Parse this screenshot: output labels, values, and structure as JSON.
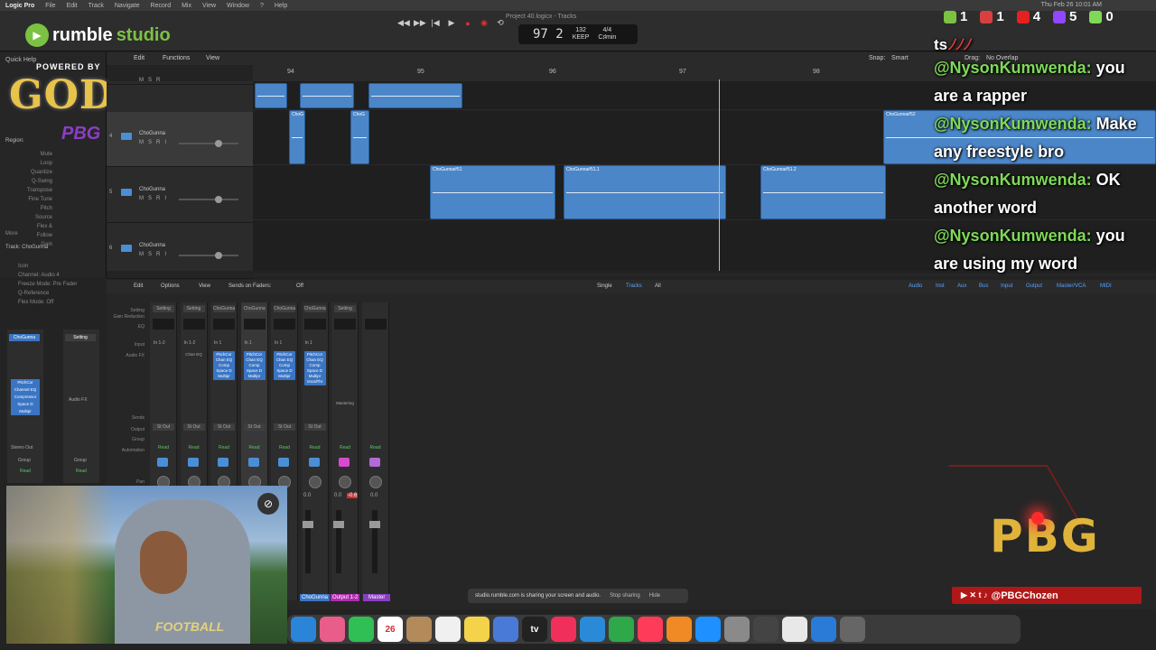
{
  "menubar": {
    "app": "Logic Pro",
    "items": [
      "File",
      "Edit",
      "Track",
      "Navigate",
      "Record",
      "Mix",
      "View",
      "Window",
      "?",
      "Help"
    ],
    "clock": "Thu Feb 26 10:01 AM"
  },
  "window": {
    "title": "Project 40.logicx - Tracks"
  },
  "transport": {
    "rewind": "◀◀",
    "forward": "▶▶",
    "to_start": "|◀",
    "play": "▶",
    "record": "●",
    "capture": "◉",
    "cycle": "⟲",
    "position": "97 2",
    "tempo": "132",
    "tempo_label": "KEEP",
    "signature": "4/4",
    "key": "C♯min"
  },
  "rumble": {
    "brand": "rumble",
    "product": "studio"
  },
  "viewers": [
    {
      "platform": "rumble",
      "count": "1",
      "color": "#7bc242"
    },
    {
      "platform": "kick",
      "count": "1",
      "color": "#d84040"
    },
    {
      "platform": "youtube",
      "count": "4",
      "color": "#e62020"
    },
    {
      "platform": "twitch",
      "count": "5",
      "color": "#9146ff"
    },
    {
      "platform": "link",
      "count": "0",
      "color": "#7fd957"
    }
  ],
  "tracks_toolbar": {
    "edit": "Edit",
    "functions": "Functions",
    "view": "View",
    "snap_label": "Snap:",
    "snap_value": "Smart",
    "drag_label": "Drag:",
    "drag_value": "No Overlap"
  },
  "inspector": {
    "quick_help": "Quick Help",
    "region_label": "Region:",
    "track_label": "Track: ChoGunna",
    "rows": [
      "Mute",
      "Loop",
      "Quantize",
      "Q-Swing",
      "Transpose",
      "Fine Tune",
      "Pitch Source",
      "Flex & Follow",
      "Gain",
      "More",
      "Icon",
      "Channel: Audio 4",
      "Freeze Mode: Pre Fader",
      "Q-Reference",
      "Flex Mode: Off"
    ]
  },
  "overlay_logo": {
    "powered_by": "POWERED BY",
    "god": "GOD",
    "pbg": "PBG"
  },
  "tracks": [
    {
      "num": "",
      "name": "",
      "selected": false
    },
    {
      "num": "4",
      "name": "ChoGunna",
      "selected": true
    },
    {
      "num": "5",
      "name": "ChoGunna",
      "selected": false
    },
    {
      "num": "6",
      "name": "ChoGunna",
      "selected": false
    }
  ],
  "track_buttons": [
    "M",
    "S",
    "R",
    "I"
  ],
  "ruler": {
    "marks": [
      "94",
      "95",
      "96",
      "97",
      "98"
    ]
  },
  "regions": {
    "r1": "ChoG",
    "r2": "ChoG",
    "r3": "ChoGunna#52",
    "r4": "ChoGunna#51",
    "r5": "ChoGunna#51.1",
    "r6": "ChoGunna#51.2"
  },
  "mixer_toolbar": {
    "edit": "Edit",
    "options": "Options",
    "view": "View",
    "sends_on_faders": "Sends on Faders:",
    "sends_value": "Off",
    "single": "Single",
    "tracks": "Tracks",
    "all": "All",
    "filters": [
      "Audio",
      "Inst",
      "Aux",
      "Bus",
      "Input",
      "Output",
      "Master/VCA",
      "MIDI"
    ]
  },
  "mixer_labels": [
    "Setting",
    "Gain Reduction",
    "EQ",
    "Input",
    "Audio FX",
    "Sends",
    "Output",
    "Group",
    "Automation",
    "Pan"
  ],
  "strips": [
    {
      "setting": "Setting",
      "input": "In 1-2",
      "fx": "",
      "out": "St Out",
      "auto": "Read",
      "color": "#4a8fd6",
      "selected": false
    },
    {
      "setting": "Setting",
      "input": "In 1-2",
      "fx": "Chan EQ",
      "out": "St Out",
      "auto": "Read",
      "color": "#4a8fd6",
      "selected": false
    },
    {
      "setting": "ChoGunna",
      "input": "In 1",
      "fx": "PitchCor\nChan EQ\nComp\nSpace D\nMultipr",
      "out": "St Out",
      "auto": "Read",
      "color": "#4a8fd6",
      "selected": false
    },
    {
      "setting": "ChoGunna",
      "input": "In 1",
      "fx": "PitchCor\nChan EQ\nComp\nSpace D\nMultipr",
      "out": "St Out",
      "auto": "Read",
      "color": "#4a8fd6",
      "selected": true
    },
    {
      "setting": "ChoGunna",
      "input": "In 1",
      "fx": "PitchCor\nChan EQ\nComp\nSpace D\nMultipr",
      "out": "St Out",
      "auto": "Read",
      "color": "#4a8fd6",
      "selected": false
    },
    {
      "setting": "ChoGunna",
      "input": "In 1",
      "fx": "PitchCor\nChan EQ\nComp\nSpace D\nMultipr\nVocalThr",
      "out": "St Out",
      "auto": "Read",
      "color": "#4a8fd6",
      "selected": false
    },
    {
      "setting": "Setting",
      "input": "",
      "fx": "Mastering",
      "out": "",
      "auto": "Read",
      "color": "#d64ad0",
      "selected": false
    },
    {
      "setting": "",
      "input": "",
      "fx": "",
      "out": "",
      "auto": "Read",
      "color": "#b36ad6",
      "selected": false
    }
  ],
  "insp_strips": [
    {
      "name": "ChoGunna",
      "fx": "PitchCor\nChannel EQ\nCompressor\nSpace D\nMultipr",
      "send": "Stereo Out",
      "group": "Group",
      "auto": "Read"
    },
    {
      "name": "Setting",
      "fx": "Audio FX",
      "send": "",
      "group": "Group",
      "auto": "Read"
    }
  ],
  "bottom_strip_labels": {
    "values": [
      "0.0",
      "0.0",
      "-0.6",
      "0.0"
    ],
    "names": [
      "ChoGunna",
      "Output 1-2",
      "Master"
    ]
  },
  "share_banner": {
    "text": "studio.rumble.com is sharing your screen and audio.",
    "stop": "Stop sharing",
    "hide": "Hide"
  },
  "webcam": {
    "shirt_text": "FOOTBALL"
  },
  "dock": [
    "Finder",
    "Photos",
    "FaceTime",
    "26",
    "Contacts",
    "Reminders",
    "Notes",
    "Freeform",
    "tv",
    "Music",
    "Keynote",
    "Numbers",
    "News",
    "Pages",
    "App Store",
    "Settings",
    "Logic",
    "Chrome",
    "Safari",
    "Trash"
  ],
  "chat": {
    "top_fragment": "ts",
    "top_red": "ﾉﾉﾉ",
    "messages": [
      {
        "user": "@NysonKumwenda:",
        "text": "you are a rapper"
      },
      {
        "user": "@NysonKumwenda:",
        "text": "Make any freestyle bro"
      },
      {
        "user": "@NysonKumwenda:",
        "text": "OK another word"
      },
      {
        "user": "@NysonKumwenda:",
        "text": "you are using my word"
      }
    ]
  },
  "pbg_logo": "PBG",
  "social": {
    "icons": "▶ ✕ t ♪",
    "handle": "@PBGChozen"
  }
}
